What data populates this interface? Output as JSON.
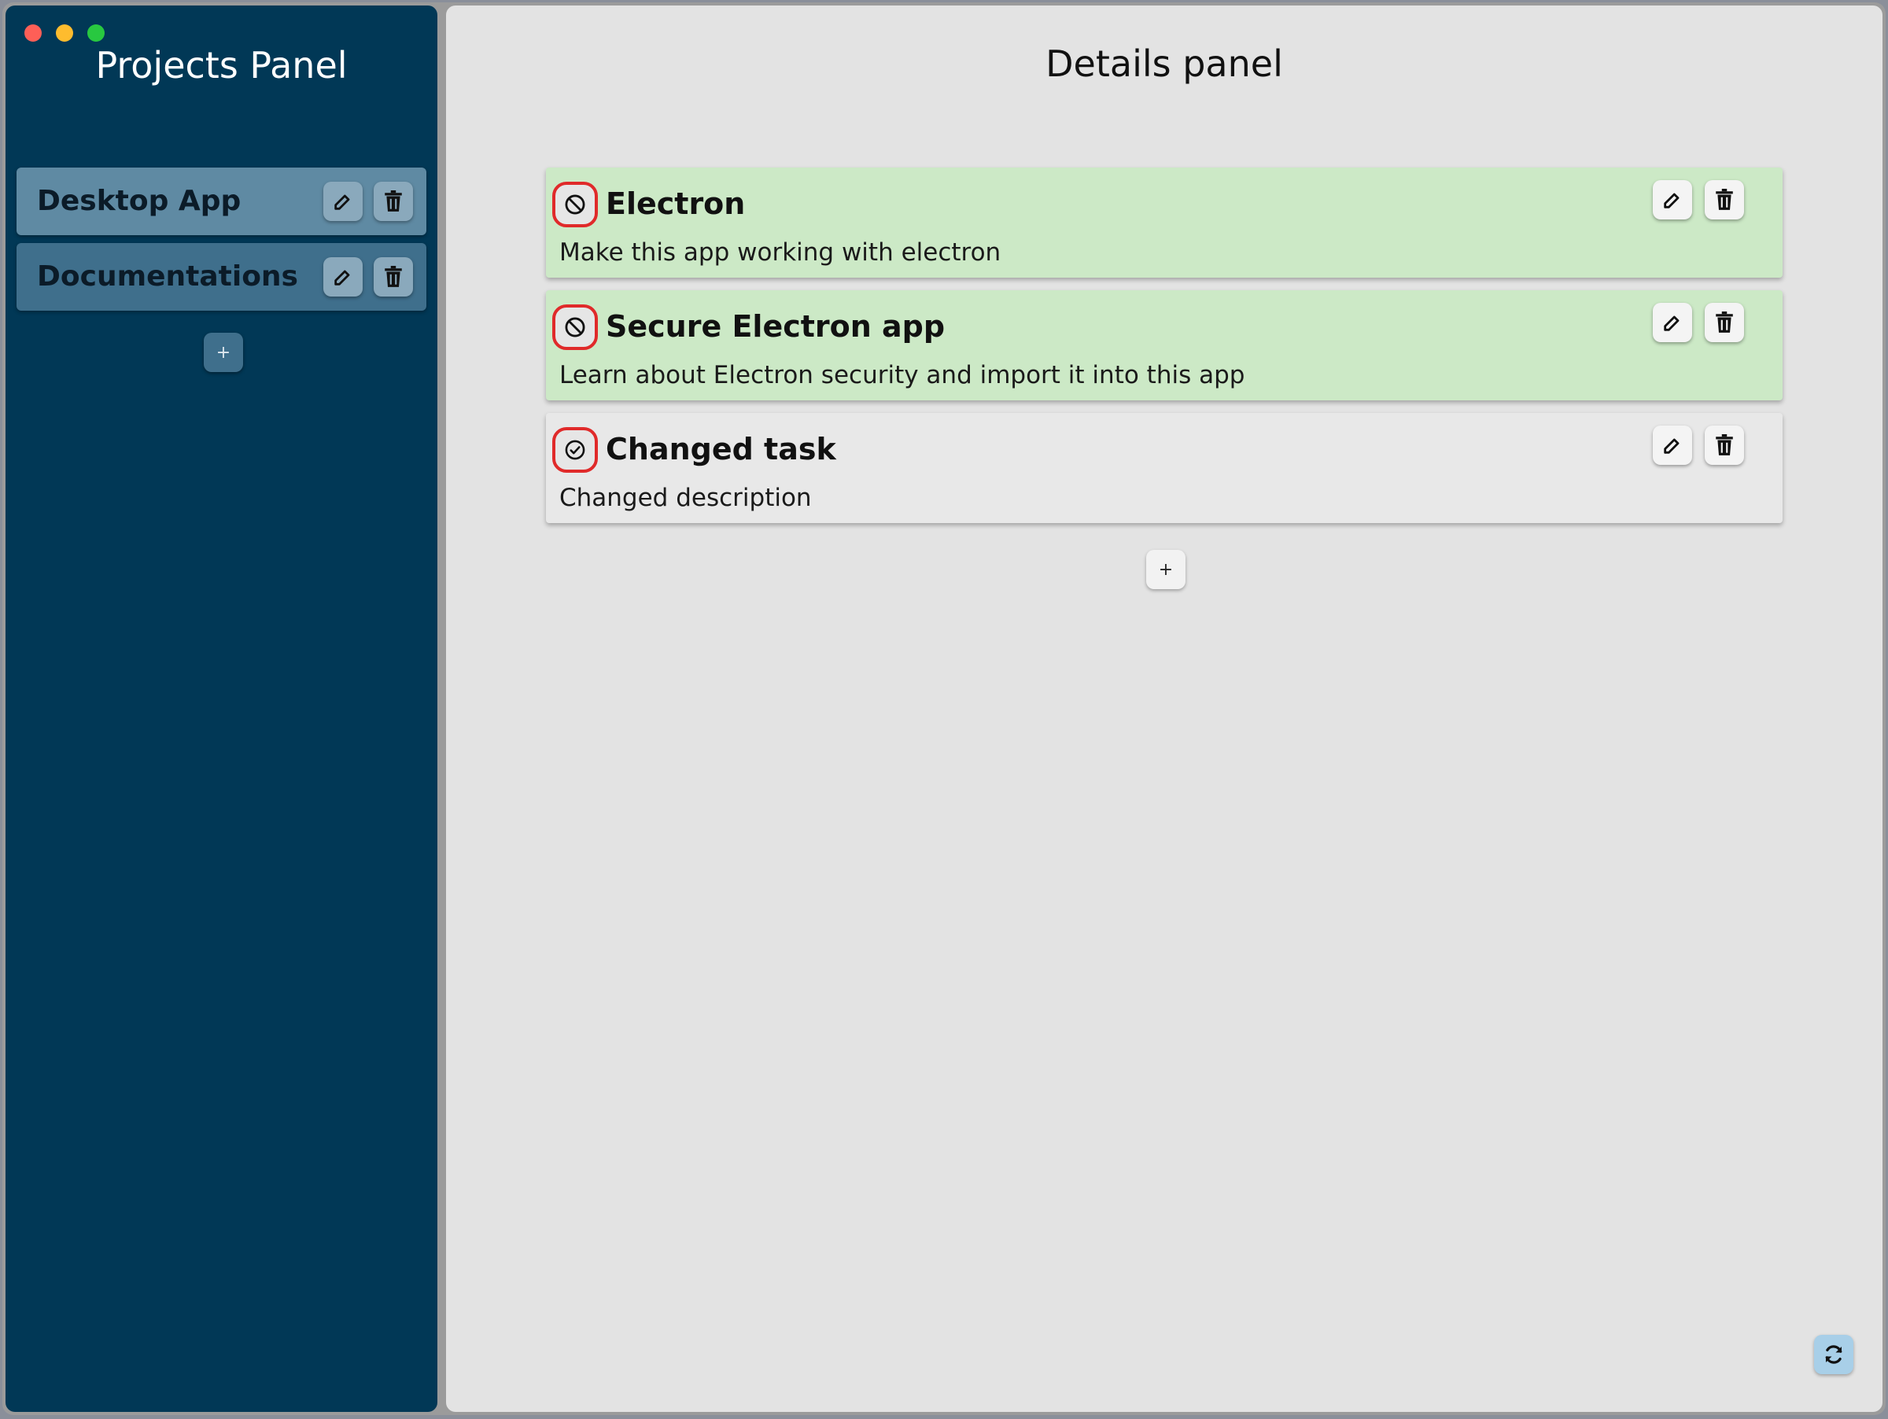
{
  "colors": {
    "sidebar_bg": "#013856",
    "project_selected": "#5f8aa3",
    "project_item": "#3f6f8c",
    "main_bg": "#e3e3e3",
    "task_done": "#cce9c6",
    "task_open": "#e8e8e8",
    "status_outline": "#e02a2a"
  },
  "sidebar": {
    "title": "Projects Panel",
    "projects": [
      {
        "label": "Desktop App",
        "edit_icon": "edit-icon",
        "delete_icon": "trash-icon"
      },
      {
        "label": "Documentations",
        "edit_icon": "edit-icon",
        "delete_icon": "trash-icon"
      }
    ],
    "add_label": "+"
  },
  "main": {
    "title": "Details panel",
    "tasks": [
      {
        "title": "Electron",
        "description": "Make this app working with electron",
        "status_icon": "ban-icon"
      },
      {
        "title": "Secure Electron app",
        "description": "Learn about Electron security and import it into this app",
        "status_icon": "ban-icon"
      },
      {
        "title": "Changed task",
        "description": "Changed description",
        "status_icon": "check-circle-icon"
      }
    ],
    "add_label": "+",
    "refresh_icon": "refresh-icon"
  }
}
